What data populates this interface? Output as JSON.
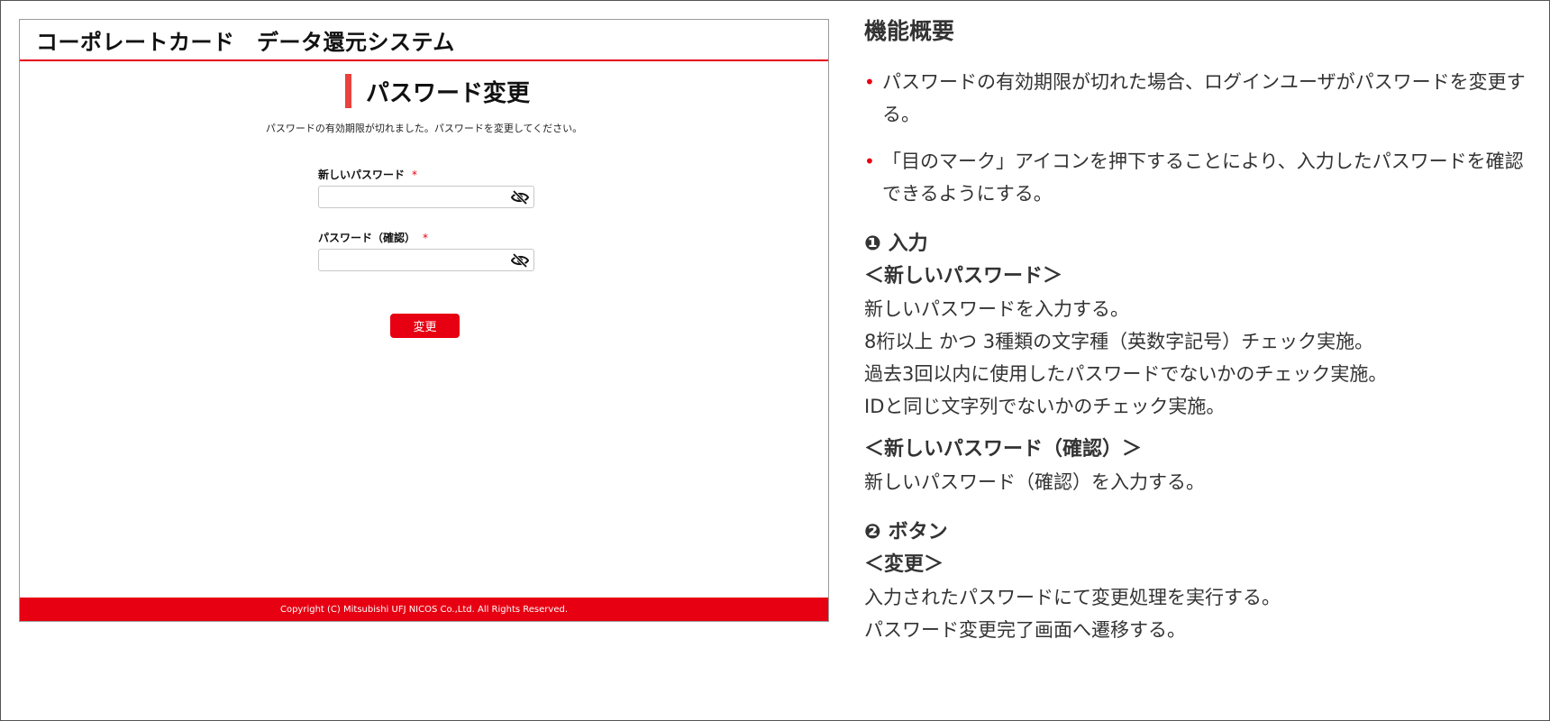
{
  "mock": {
    "system_title": "コーポレートカード　データ還元システム",
    "page_title": "パスワード変更",
    "expired_message": "パスワードの有効期限が切れました。パスワードを変更してください。",
    "new_password_label": "新しいパスワード",
    "confirm_password_label": "パスワード（確認）",
    "required_mark": "*",
    "new_password_value": "",
    "confirm_password_value": "",
    "submit_label": "変更",
    "copyright": "Copyright (C) Mitsubishi UFJ NICOS Co.,Ltd. All Rights Reserved.",
    "accent_color": "#e60012",
    "icons": {
      "toggle_visibility": "eye-off-icon"
    }
  },
  "description": {
    "title": "機能概要",
    "bullets": [
      "パスワードの有効期限が切れた場合、ログインユーザがパスワードを変更する。",
      "「目のマーク」アイコンを押下することにより、入力したパスワードを確認できるようにする。"
    ],
    "section1": {
      "number": "❶",
      "title": "入力",
      "sub1_title": "＜新しいパスワード＞",
      "sub1_lines": [
        "新しいパスワードを入力する。",
        "8桁以上 かつ 3種類の文字種（英数字記号）チェック実施。",
        "過去3回以内に使用したパスワードでないかのチェック実施。",
        "IDと同じ文字列でないかのチェック実施。"
      ],
      "sub2_title": "＜新しいパスワード（確認）＞",
      "sub2_lines": [
        "新しいパスワード（確認）を入力する。"
      ]
    },
    "section2": {
      "number": "❷",
      "title": "ボタン",
      "sub_title": "＜変更＞",
      "lines": [
        "入力されたパスワードにて変更処理を実行する。",
        "パスワード変更完了画面へ遷移する。"
      ]
    }
  }
}
